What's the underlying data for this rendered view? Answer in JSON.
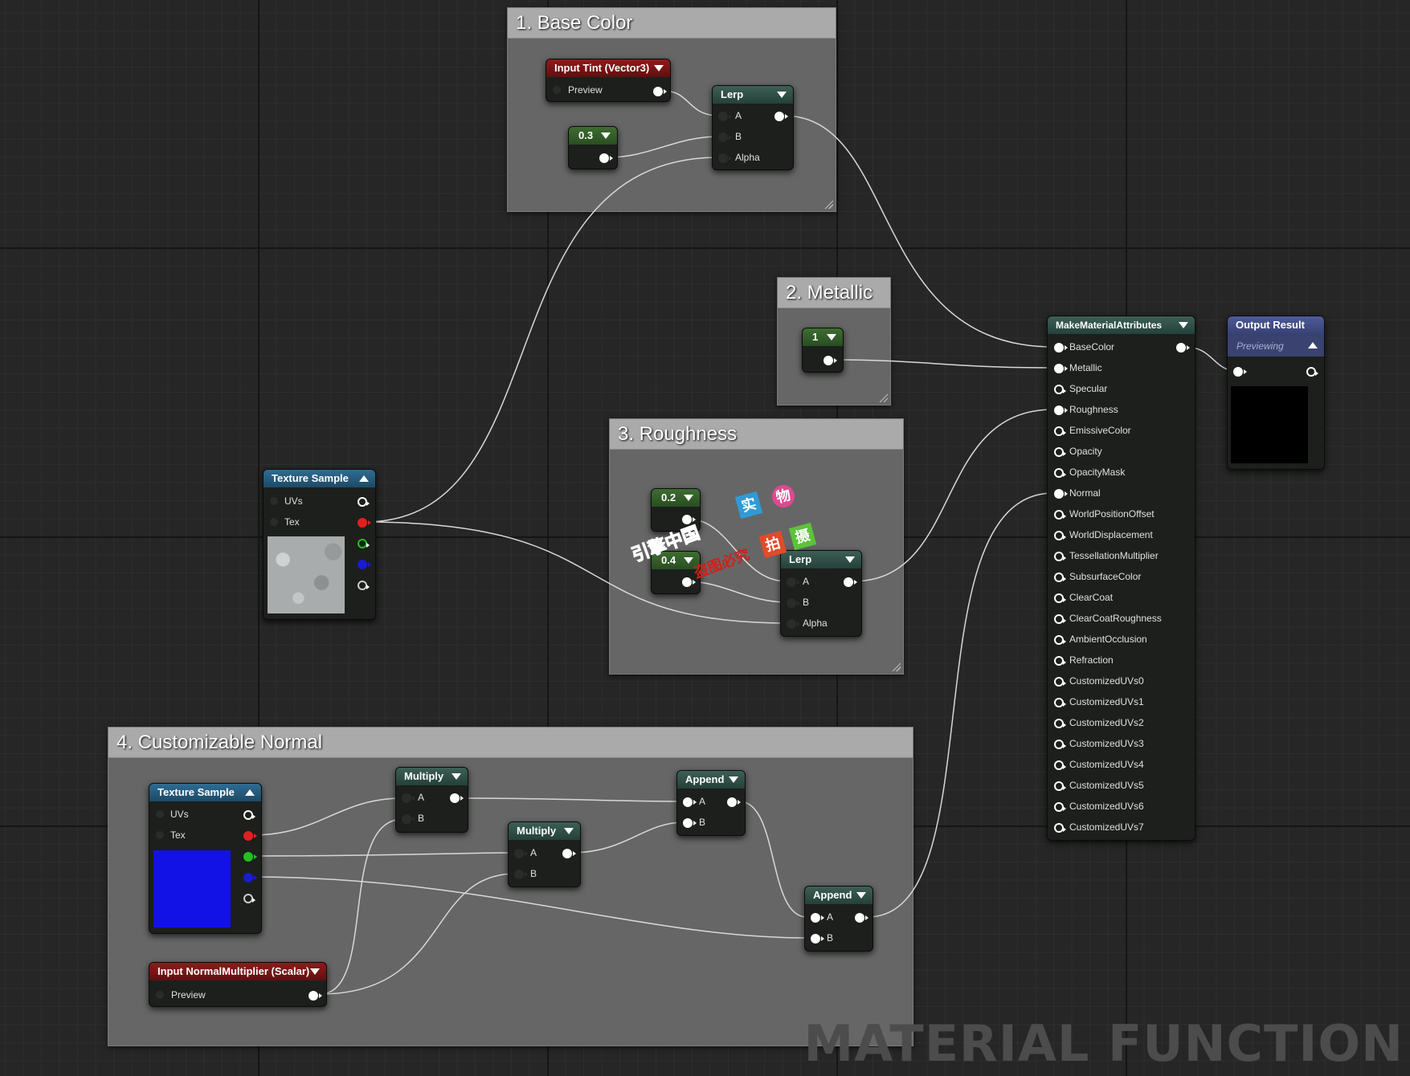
{
  "comments": {
    "base_color": "1. Base Color",
    "metallic": "2. Metallic",
    "roughness": "3. Roughness",
    "normal": "4. Customizable Normal"
  },
  "nodes": {
    "input_tint": {
      "title": "Input Tint (Vector3)",
      "preview": "Preview"
    },
    "const_03": {
      "value": "0.3"
    },
    "lerp_base": {
      "title": "Lerp",
      "a": "A",
      "b": "B",
      "alpha": "Alpha"
    },
    "const_1": {
      "value": "1"
    },
    "const_02": {
      "value": "0.2"
    },
    "const_04": {
      "value": "0.4"
    },
    "lerp_rough": {
      "title": "Lerp",
      "a": "A",
      "b": "B",
      "alpha": "Alpha"
    },
    "tex_sample_top": {
      "title": "Texture Sample",
      "uvs": "UVs",
      "tex": "Tex"
    },
    "tex_sample_bottom": {
      "title": "Texture Sample",
      "uvs": "UVs",
      "tex": "Tex"
    },
    "multiply_1": {
      "title": "Multiply",
      "a": "A",
      "b": "B"
    },
    "multiply_2": {
      "title": "Multiply",
      "a": "A",
      "b": "B"
    },
    "append_1": {
      "title": "Append",
      "a": "A",
      "b": "B"
    },
    "append_2": {
      "title": "Append",
      "a": "A",
      "b": "B"
    },
    "input_normal_mult": {
      "title": "Input NormalMultiplier (Scalar)",
      "preview": "Preview"
    },
    "make_material": {
      "title": "MakeMaterialAttributes",
      "pins": [
        "BaseColor",
        "Metallic",
        "Specular",
        "Roughness",
        "EmissiveColor",
        "Opacity",
        "OpacityMask",
        "Normal",
        "WorldPositionOffset",
        "WorldDisplacement",
        "TessellationMultiplier",
        "SubsurfaceColor",
        "ClearCoat",
        "ClearCoatRoughness",
        "AmbientOcclusion",
        "Refraction",
        "CustomizedUVs0",
        "CustomizedUVs1",
        "CustomizedUVs2",
        "CustomizedUVs3",
        "CustomizedUVs4",
        "CustomizedUVs5",
        "CustomizedUVs6",
        "CustomizedUVs7"
      ],
      "connected": [
        "BaseColor",
        "Metallic",
        "Roughness",
        "Normal"
      ]
    },
    "output_result": {
      "title": "Output Result",
      "subtitle": "Previewing"
    }
  },
  "overlay": {
    "watermark": "MATERIAL FUNCTION",
    "stamp_chars": [
      "实",
      "物",
      "拍",
      "摄"
    ],
    "stamp_line1": "引擎中国",
    "stamp_line2": "盗图必究"
  },
  "colors": {
    "comment_bg": "#666666",
    "comment_title": "#aaaaaa",
    "header_constant": "#3e6d32",
    "header_parameter": "#8e1b1b",
    "header_texture": "#2f6c92",
    "header_function": "#3d5f55",
    "header_output": "#4f5a98"
  }
}
